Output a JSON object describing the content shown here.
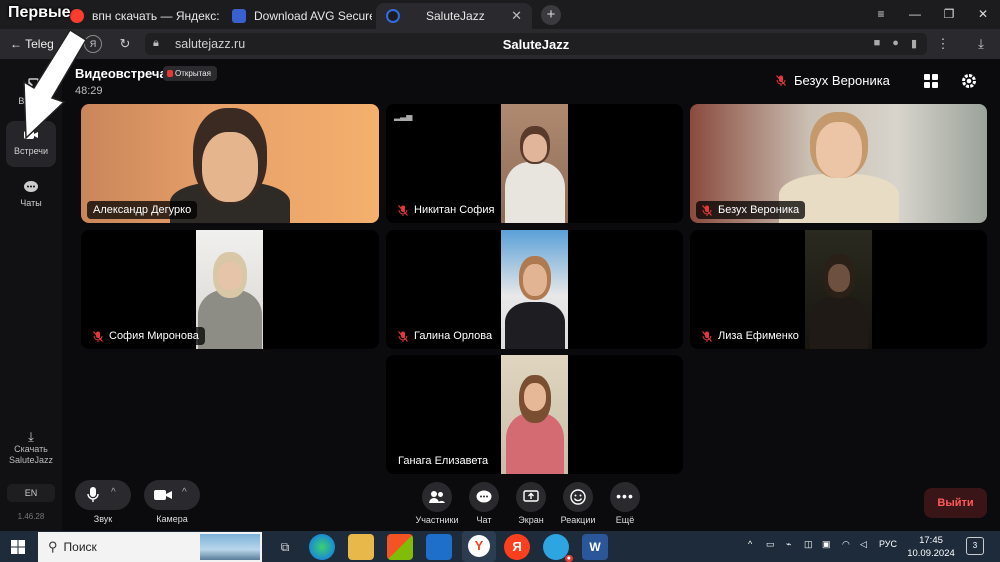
{
  "browser": {
    "tabs": [
      {
        "label": "впн скачать — Яндекс: на",
        "favicon_color": "#ff3d2e"
      },
      {
        "label": "Download AVG Secure VP",
        "favicon_color": "#3a5fd0"
      },
      {
        "label": "SaluteJazz",
        "favicon_color": "#2f6de0",
        "active": true
      }
    ],
    "back_label": "Teleg",
    "url": "salutejazz.ru",
    "page_title": "SaluteJazz"
  },
  "sidebar": {
    "items": [
      {
        "label": "Войти"
      },
      {
        "label": "Встречи"
      },
      {
        "label": "Чаты"
      }
    ],
    "download_label_1": "Скачать",
    "download_label_2": "SaluteJazz",
    "language": "EN",
    "version": "1.46.28"
  },
  "meeting": {
    "title": "Видеовстреча",
    "badge": "Открытая",
    "timer": "48:29",
    "active_speaker": "Безух Вероника"
  },
  "participants": [
    {
      "name": "Александр Дегурко",
      "muted": false
    },
    {
      "name": "Никитан София",
      "muted": true
    },
    {
      "name": "Безух Вероника",
      "muted": true
    },
    {
      "name": "София Миронова",
      "muted": true
    },
    {
      "name": "Галина Орлова",
      "muted": true
    },
    {
      "name": "Лиза Ефименко",
      "muted": true
    },
    {
      "name": "Ганага Елизавета",
      "muted": false
    }
  ],
  "controls": {
    "sound": "Звук",
    "camera": "Камера",
    "participants": "Участники",
    "chat": "Чат",
    "screen": "Экран",
    "reactions": "Реакции",
    "more": "Ещё",
    "leave": "Выйти"
  },
  "taskbar": {
    "search_placeholder": "Поиск",
    "language": "РУС",
    "time": "17:45",
    "date": "10.09.2024",
    "notifications": "3"
  },
  "overlay": {
    "caption": "Первые"
  },
  "colors": {
    "accent_red": "#e53935",
    "leave_text": "#ff5a5a",
    "taskbar": "#1d2b3a"
  }
}
